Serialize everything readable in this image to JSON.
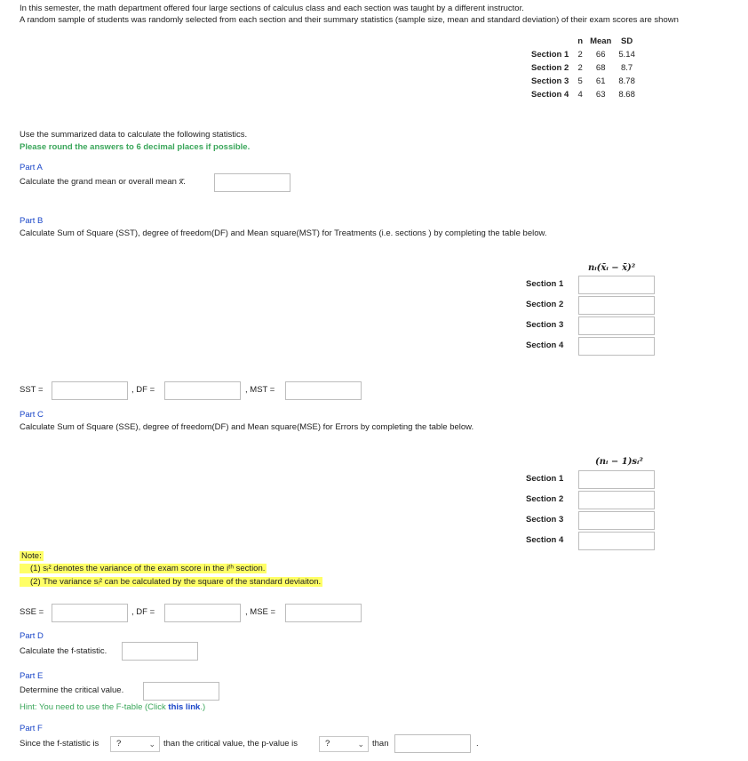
{
  "intro": {
    "line1": "In this semester, the math department offered four large sections of calculus class and each section was taught by a different instructor.",
    "line2": "A random sample of students was randomly selected from each section and their summary statistics (sample size, mean and standard deviation) of their exam scores are shown"
  },
  "summary_table": {
    "headers": [
      "n",
      "Mean",
      "SD"
    ],
    "rows": [
      {
        "label": "Section 1",
        "n": "2",
        "mean": "66",
        "sd": "5.14"
      },
      {
        "label": "Section 2",
        "n": "2",
        "mean": "68",
        "sd": "8.7"
      },
      {
        "label": "Section 3",
        "n": "5",
        "mean": "61",
        "sd": "8.78"
      },
      {
        "label": "Section 4",
        "n": "4",
        "mean": "63",
        "sd": "8.68"
      }
    ]
  },
  "instructions": {
    "use": "Use the summarized data to calculate the following statistics.",
    "round": "Please round the answers to 6 decimal places if possible."
  },
  "partA": {
    "title": "Part A",
    "prompt": "Calculate the grand mean or overall mean x̄̄."
  },
  "partB": {
    "title": "Part B",
    "prompt": "Calculate Sum of Square (SST), degree of freedom(DF) and Mean square(MST) for Treatments (i.e. sections ) by completing the table below.",
    "column_header": "nᵢ(x̄ᵢ − x̄̄)²",
    "sections": [
      "Section 1",
      "Section 2",
      "Section 3",
      "Section 4"
    ],
    "sst_label": "SST =",
    "df_label": ", DF =",
    "mst_label": ", MST ="
  },
  "partC": {
    "title": "Part C",
    "prompt": "Calculate Sum of Square (SSE), degree of freedom(DF) and Mean square(MSE) for Errors by completing the table below.",
    "column_header": "(nᵢ − 1)sᵢ²",
    "sections": [
      "Section 1",
      "Section 2",
      "Section 3",
      "Section 4"
    ],
    "note_title": "Note:",
    "note1": "(1) sᵢ² denotes the variance of the exam score in the iᵗʰ section.",
    "note2": "(2) The variance sᵢ² can be calculated by the square of the standard deviaiton.",
    "sse_label": "SSE =",
    "df_label": ", DF =",
    "mse_label": ", MSE ="
  },
  "partD": {
    "title": "Part D",
    "prompt": "Calculate the f-statistic."
  },
  "partE": {
    "title": "Part E",
    "prompt": "Determine the critical value.",
    "hint_prefix": "Hint: You need to use the F-table (Click ",
    "hint_link": "this link",
    "hint_suffix": ".)"
  },
  "partF": {
    "title": "Part F",
    "prefix": "Since the f-statistic is",
    "select1": "?",
    "middle": "than the critical value, the p-value is",
    "select2": "?",
    "suffix": "than",
    "end": "."
  }
}
